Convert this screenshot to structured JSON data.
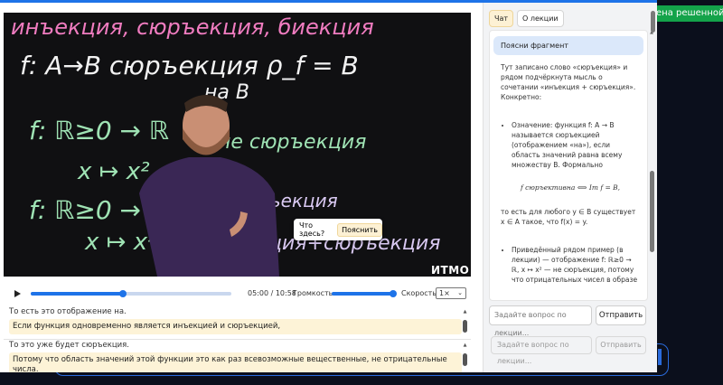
{
  "background": {
    "status_badge": "ена решенной"
  },
  "tooltip": {
    "question": "Что здесь?",
    "explain_label": "Пояснить"
  },
  "video": {
    "logo": "ИTMO"
  },
  "controls": {
    "time": "05:00 / 10:58",
    "progress_fraction": 0.46,
    "volume_label": "Громкость",
    "volume_fraction": 1.0,
    "speed_label": "Скорость",
    "speed_value": "1×"
  },
  "subtitles": {
    "block1_faded": "То есть это отображение на.",
    "block1_highlight": "Если функция одновременно является инъекцией и сюръекцией,",
    "block2_faded": "То это уже будет сюръекция.",
    "block2_highlight": "Потому что область значений этой функции это как раз всевозможные вещественные, не отрицательные числа."
  },
  "panel": {
    "tabs": [
      {
        "label": "Чат",
        "active": true
      },
      {
        "label": "О лекции",
        "active": false
      }
    ],
    "user_message": "Поясни фрагмент",
    "bot_intro": "Тут записано слово «сюръекция» и рядом подчёркнута мысль о сочетании «инъекция + сюръекция». Конкретно:",
    "bullet1": "Означение: функция f: A → B называется сюръекцией (отображением «на»), если область значений равна всему множеству B. Формально",
    "formula": "f сюръективна ⟺ Im f = B,",
    "after_formula": "то есть для любого y ∈ B существует x ∈ A такое, что f(x) = y.",
    "bullet2": "Приведённый рядом пример (в лекции) — отображение f: ℝ≥0 → ℝ, x ↦ x² — не сюръекция, потому что отрицательных чисел в образе",
    "input_placeholder": "Задайте вопрос по лекции...",
    "send_label": "Отправить",
    "ghost_placeholder": "Задайте вопрос по лекции...",
    "ghost_send": "Отправить"
  }
}
